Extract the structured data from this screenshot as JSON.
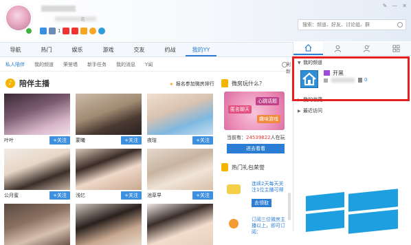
{
  "header": {
    "signature_fragment": "名",
    "badge_count": "1",
    "search": {
      "placeholder": "搜索：频道、好友、讨论组、群"
    }
  },
  "nav": {
    "tabs": [
      "导航",
      "热门",
      "娱乐",
      "游戏",
      "交友",
      "约战",
      "我的YY"
    ],
    "active_index": 6
  },
  "subnav": {
    "items": [
      "私人陪伴",
      "我的频道",
      "荣誉墙",
      "新手任务",
      "我的消息",
      "Y闻"
    ],
    "active_index": 0,
    "refresh_label": "刷新"
  },
  "section": {
    "title": "陪伴主播",
    "rank_link": "报名参加微房排行"
  },
  "hosts": [
    {
      "name": "叶叶",
      "follow": "+关注"
    },
    {
      "name": "蒙曦",
      "follow": "+关注"
    },
    {
      "name": "夜瑄",
      "follow": "+关注"
    },
    {
      "name": "公月蜜",
      "follow": "+关注"
    },
    {
      "name": "浅忆",
      "follow": "+关注"
    },
    {
      "name": "池草早",
      "follow": "+关注"
    },
    {
      "name": "",
      "follow": ""
    },
    {
      "name": "",
      "follow": ""
    },
    {
      "name": "",
      "follow": ""
    }
  ],
  "promo": {
    "title": "微房玩什么？",
    "tags": [
      "匿名聊天",
      "心跳话题",
      "趣味游戏"
    ],
    "online_prefix": "当前有：",
    "online_count": "24539822",
    "online_suffix": "人在玩",
    "button": "进去看看"
  },
  "gifts": {
    "title": "热门礼包荣誉",
    "gift1_text": "连续2天每天关注1位主播可得",
    "gift1_button": "去领取",
    "gift2_text": "订阅三位微房主播以上，即可订阅："
  },
  "right_panel": {
    "tabs": [
      "home-icon",
      "user-icon",
      "users-icon",
      "apps-icon"
    ],
    "tree": {
      "my_channel": "我的频道",
      "my_favorites": "我的收藏",
      "recent": "最近访问"
    },
    "channel": {
      "name": "开黑",
      "count": "0"
    }
  },
  "window_controls": [
    "skin-icon",
    "minimize-icon",
    "close-icon"
  ]
}
